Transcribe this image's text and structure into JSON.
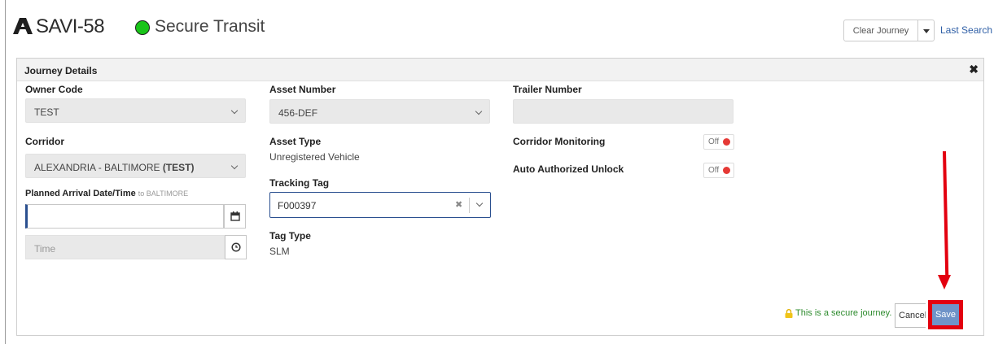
{
  "header": {
    "app_name": "SAVI-58",
    "status_text": "Secure Transit",
    "status_color": "#19c419",
    "clear_button": "Clear Journey",
    "last_search": "Last Search"
  },
  "panel": {
    "title": "Journey Details",
    "close_icon": "close-icon"
  },
  "fields": {
    "owner_code": {
      "label": "Owner Code",
      "value": "TEST"
    },
    "corridor": {
      "label": "Corridor",
      "value_prefix": "ALEXANDRIA - BALTIMORE ",
      "value_bold": "(TEST)"
    },
    "planned_arrival": {
      "label": "Planned Arrival Date/Time",
      "hint": "to BALTIMORE",
      "date_value": "",
      "time_placeholder": "Time"
    },
    "asset_number": {
      "label": "Asset Number",
      "value": "456-DEF"
    },
    "asset_type": {
      "label": "Asset Type",
      "value": "Unregistered Vehicle"
    },
    "tracking_tag": {
      "label": "Tracking Tag",
      "value": "F000397"
    },
    "tag_type": {
      "label": "Tag Type",
      "value": "SLM"
    },
    "trailer_number": {
      "label": "Trailer Number",
      "value": ""
    },
    "corridor_monitoring": {
      "label": "Corridor Monitoring",
      "state": "Off"
    },
    "auto_unlock": {
      "label": "Auto Authorized Unlock",
      "state": "Off"
    }
  },
  "footer": {
    "secure_note": "This is a secure journey.",
    "cancel_label": "Cancel",
    "save_label": "Save"
  },
  "colors": {
    "accent": "#2a4f8f",
    "save": "#6f93c8",
    "highlight": "#e3000f",
    "toggle_off": "#e53935"
  }
}
